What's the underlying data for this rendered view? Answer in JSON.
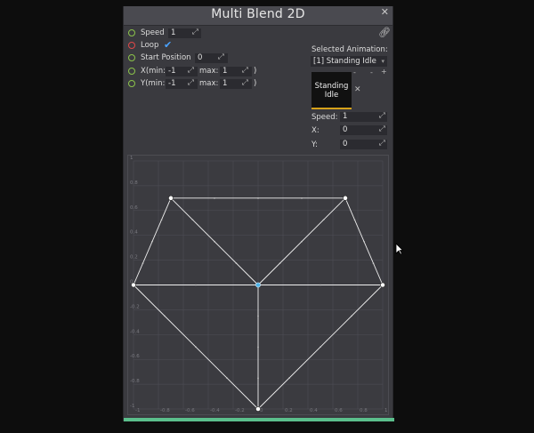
{
  "window": {
    "title": "Multi Blend 2D"
  },
  "params": {
    "speed_label": "Speed",
    "speed_value": "1",
    "loop_label": "Loop",
    "loop_checked": true,
    "start_label": "Start Position",
    "start_value": "0",
    "x_label": "X(min:",
    "x_min": "-1",
    "x_max_label": "max:",
    "x_max": "1",
    "y_label": "Y(min:",
    "y_min": "-1",
    "y_max_label": "max:",
    "y_max": "1",
    "close_paren": ")"
  },
  "selected": {
    "heading": "Selected Animation:",
    "animation": "[1] Standing Idle",
    "tile_line1": "Standing",
    "tile_line2": "Idle",
    "speed_label": "Speed:",
    "speed_value": "1",
    "x_label": "X:",
    "x_value": "0",
    "y_label": "Y:",
    "y_value": "0"
  },
  "graph": {
    "x_range": [
      -1,
      1
    ],
    "y_range": [
      -1,
      1
    ],
    "x_ticks": [
      "-1",
      "-0.8",
      "-0.6",
      "-0.4",
      "-0.2",
      "0",
      "0.2",
      "0.4",
      "0.6",
      "0.8",
      "1"
    ],
    "y_ticks": [
      "1",
      "0.8",
      "0.6",
      "0.4",
      "0.2",
      "0",
      "-0.2",
      "-0.4",
      "-0.6",
      "-0.8",
      "-1"
    ],
    "points": [
      {
        "x": -1,
        "y": 0
      },
      {
        "x": -0.7,
        "y": 0.7
      },
      {
        "x": 0,
        "y": 0,
        "selected": true
      },
      {
        "x": 0.7,
        "y": 0.7
      },
      {
        "x": 1,
        "y": 0
      },
      {
        "x": 0,
        "y": -1
      }
    ],
    "edges": [
      [
        0,
        1
      ],
      [
        1,
        3
      ],
      [
        3,
        4
      ],
      [
        0,
        4
      ],
      [
        1,
        2
      ],
      [
        2,
        3
      ],
      [
        0,
        5
      ],
      [
        5,
        4
      ],
      [
        2,
        5
      ]
    ],
    "colors": {
      "line": "#f0f0f0",
      "selected": "#4fb3e8",
      "grid": "#505057"
    }
  }
}
